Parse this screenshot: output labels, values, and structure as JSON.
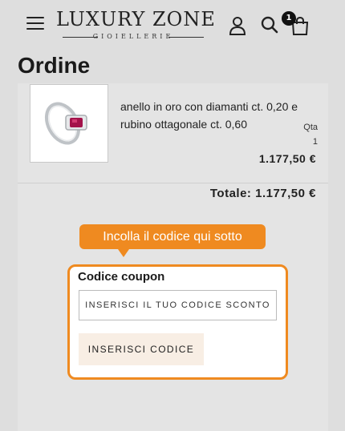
{
  "header": {
    "logo_main": "LUXURY ZONE",
    "logo_sub": "GIOIELLERIE",
    "cart_count": "1",
    "icons": [
      "hamburger-menu-icon",
      "user-icon",
      "search-icon",
      "shopping-bag-icon"
    ]
  },
  "page": {
    "title": "Ordine"
  },
  "order": {
    "item": {
      "name": "anello in oro con diamanti ct. 0,20 e rubino ottagonale ct. 0,60",
      "qty_label": "Qta",
      "qty": "1",
      "price": "1.177,50 €"
    },
    "total": "Totale: 1.177,50 €"
  },
  "tooltip": {
    "text": "Incolla il codice qui sotto"
  },
  "coupon": {
    "title": "Codice coupon",
    "placeholder": "INSERISCI IL TUO CODICE SCONTO",
    "button_label": "INSERISCI CODICE"
  },
  "colors": {
    "accent": "#ef8a20",
    "background": "#dedede",
    "button_bg": "#f8eee4"
  }
}
